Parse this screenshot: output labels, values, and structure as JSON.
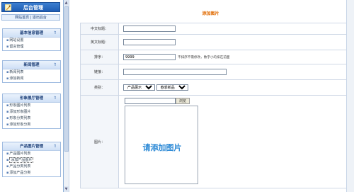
{
  "sidebar": {
    "logo_title": "后台管理",
    "quick_links": "网站首页 | 退出后台",
    "panels": [
      {
        "title": "基本信息管理",
        "items": [
          "网站设置",
          "留言管理"
        ]
      },
      {
        "title": "新闻管理",
        "items": [
          "新闻列表",
          "添加新闻"
        ]
      },
      {
        "title": "形象展厅管理",
        "items": [
          "形象图片列表",
          "添加形象图片",
          "形象分类列表",
          "添加形象分类"
        ]
      },
      {
        "title": "产品图片管理",
        "items": [
          "产品图片列表",
          "添加产品图片",
          "产品分类列表",
          "添加产品分类"
        ]
      }
    ],
    "active_item": "添加产品图片",
    "collapse_glyph": "⇑"
  },
  "main": {
    "page_title": "添加图片",
    "fields": {
      "cn_title_label": "中文标题：",
      "cn_title_value": "",
      "en_title_label": "英文标题：",
      "en_title_value": "",
      "sort_label": "排序：",
      "sort_value": "9999",
      "sort_hint": "不排序不需修改，数字小的排在前面",
      "link_label": "链接：",
      "link_value": "",
      "category_label": "类别：",
      "category_primary": "产品展示",
      "category_secondary": "春季新品",
      "image_label": "图片：",
      "browse_label": "浏览",
      "placeholder_text": "请添加图片"
    }
  }
}
